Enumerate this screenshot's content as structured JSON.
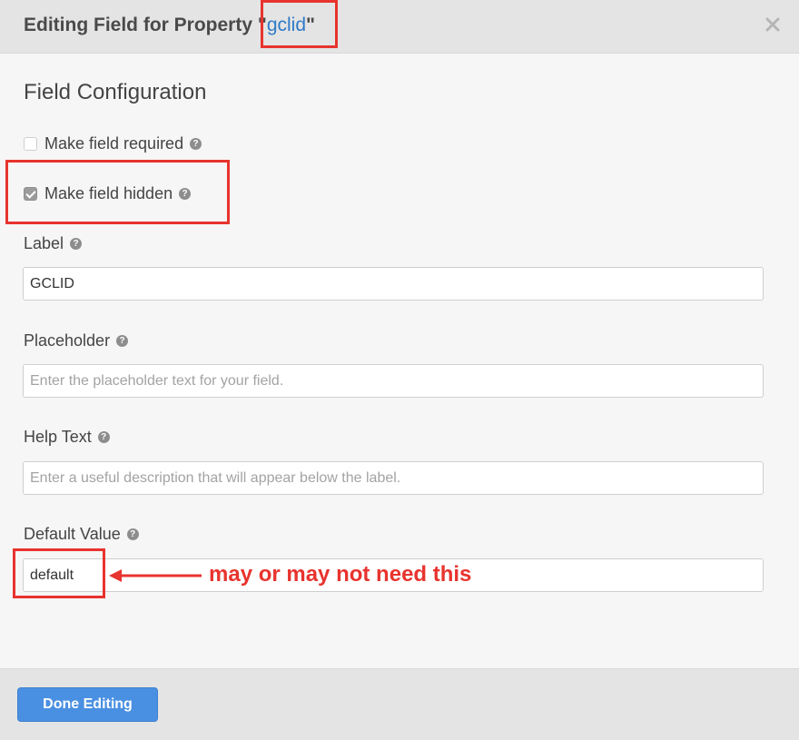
{
  "dialog": {
    "title_prefix": "Editing Field for Property ",
    "quote_open": "\"",
    "property_name": "gclid",
    "quote_close": "\"",
    "close_icon": "close-icon"
  },
  "section": {
    "title": "Field Configuration"
  },
  "checkboxes": {
    "required": {
      "label": "Make field required",
      "checked": false
    },
    "hidden": {
      "label": "Make field hidden",
      "checked": true
    }
  },
  "fields": {
    "label": {
      "label": "Label",
      "value": "GCLID",
      "placeholder": ""
    },
    "placeholder": {
      "label": "Placeholder",
      "value": "",
      "placeholder": "Enter the placeholder text for your field."
    },
    "help_text": {
      "label": "Help Text",
      "value": "",
      "placeholder": "Enter a useful description that will appear below the label."
    },
    "default_value": {
      "label": "Default Value",
      "value": "default",
      "placeholder": ""
    }
  },
  "help_icon_glyph": "?",
  "footer": {
    "done_label": "Done Editing"
  },
  "annotation": {
    "text": "may or may not need this",
    "color": "#e8332e"
  },
  "colors": {
    "accent": "#4a90e2",
    "link": "#2e7ac7",
    "annotation_red": "#e8332e"
  }
}
